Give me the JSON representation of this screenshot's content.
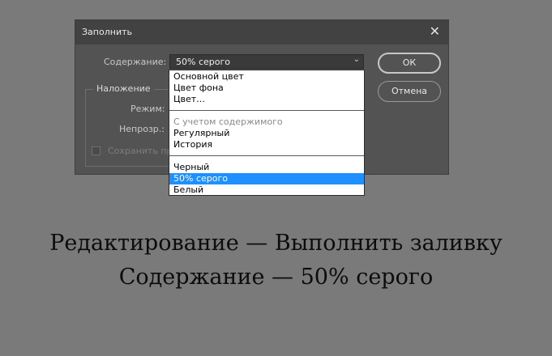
{
  "dialog": {
    "title": "Заполнить",
    "close_glyph": "✕",
    "content_label": "Содержание:",
    "selected_value": "50% серого",
    "ok_label": "ОК",
    "cancel_label": "Отмена",
    "blending_group_title": "Наложение",
    "mode_label": "Режим:",
    "opacity_label": "Непрозр.:",
    "preserve_transparency_label": "Сохранить пр",
    "dropdown_options": [
      {
        "label": "Основной цвет",
        "state": "normal"
      },
      {
        "label": "Цвет фона",
        "state": "normal"
      },
      {
        "label": "Цвет...",
        "state": "normal"
      },
      {
        "label": "С учетом содержимого",
        "state": "disabled"
      },
      {
        "label": "Регулярный",
        "state": "normal"
      },
      {
        "label": "История",
        "state": "normal"
      },
      {
        "label": "Черный",
        "state": "normal"
      },
      {
        "label": "50% серого",
        "state": "selected"
      },
      {
        "label": "Белый",
        "state": "normal"
      }
    ]
  },
  "caption": {
    "line1": "Редактирование — Выполнить заливку",
    "line2": "Содержание — 50% серого"
  },
  "colors": {
    "background": "#7a7a7a",
    "dialog_bg": "#535353",
    "selection": "#1e90ff"
  },
  "icons": {
    "close": "close-icon",
    "dropdown_arrow": "chevron-down-icon"
  }
}
